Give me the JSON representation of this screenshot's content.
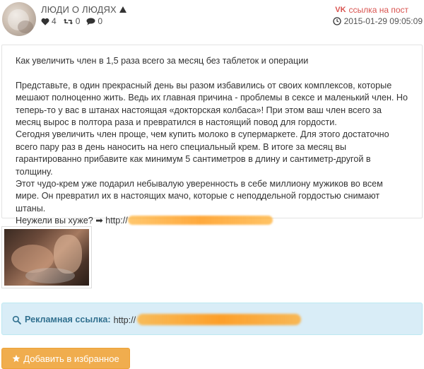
{
  "header": {
    "username": "ЛЮДИ О ЛЮДЯХ",
    "likes": "4",
    "reposts": "0",
    "comments": "0",
    "post_link_label": "ссылка на пост",
    "date": "2015-01-29 09:05:09"
  },
  "message": {
    "title": "Как увеличить член в 1,5 раза всего за месяц без таблеток и операции",
    "lines": [
      "Представьте, в один прекрасный день вы разом избавились от своих комплексов, которые мешают полноценно жить. Ведь их главная причина - проблемы в сексе и маленький член. Но теперь-то у вас в штанах настоящая «докторская колбаса»! При этом ваш член всего за месяц вырос в полтора раза и превратился в настоящий повод для гордости.",
      "Сегодня увеличить член проще, чем купить молоко в супермаркете. Для этого достаточно всего пару раз в день наносить на него специальный крем. В итоге за месяц вы гарантированно прибавите как минимум 5 сантиметров в длину и сантиметр-другой в толщину.",
      "Этот чудо-крем уже подарил небывалую уверенность в себе миллиону мужиков во всем мире. Он превратил их в настоящих мачо, которые с неподдельной гордостью снимают штаны."
    ],
    "final_line": "Неужели вы хуже? ➡ http://"
  },
  "ad": {
    "label": "Рекламная ссылка:",
    "url_prefix": "http://"
  },
  "favorite_button": {
    "label": "Добавить в избранное"
  },
  "colors": {
    "accent_red": "#d9534f",
    "info_bg": "#d9edf7",
    "info_text": "#31708f",
    "warning_button": "#f0ad4e"
  },
  "icons": [
    "heart-icon",
    "retweet-icon",
    "comment-icon",
    "vk-icon",
    "clock-icon",
    "search-icon",
    "star-icon",
    "caret-up-icon"
  ]
}
